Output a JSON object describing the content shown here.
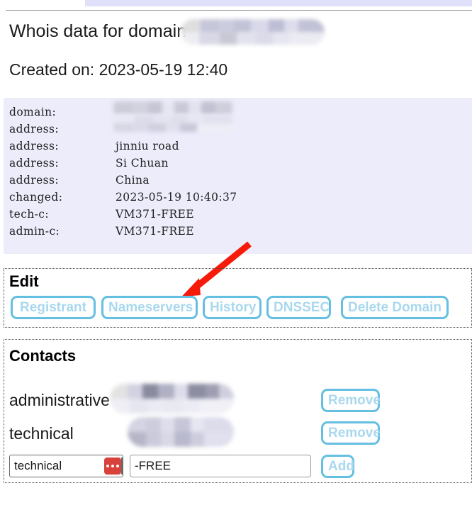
{
  "page": {
    "title": "Whois data for domain",
    "created_line": "Created on: 2023-05-19 12:40"
  },
  "whois": {
    "lines": [
      {
        "key": "domain:",
        "value": ""
      },
      {
        "key": "address:",
        "value": ""
      },
      {
        "key": "address:",
        "value": "jinniu road"
      },
      {
        "key": "address:",
        "value": "Si Chuan"
      },
      {
        "key": "address:",
        "value": "China"
      },
      {
        "key": "changed:",
        "value": "2023-05-19 10:40:37"
      },
      {
        "key": "tech-c:",
        "value": "VM371-FREE"
      },
      {
        "key": "admin-c:",
        "value": "VM371-FREE"
      }
    ]
  },
  "edit": {
    "title": "Edit",
    "buttons": [
      {
        "label": "Registrant"
      },
      {
        "label": "Nameservers"
      },
      {
        "label": "History"
      },
      {
        "label": "DNSSEC"
      },
      {
        "label": "Delete Domain"
      }
    ]
  },
  "contacts": {
    "title": "Contacts",
    "rows": [
      {
        "label": "administrative",
        "action": "Remove"
      },
      {
        "label": "technical",
        "action": "Remove"
      }
    ],
    "add_form": {
      "type_value": "technical",
      "handle_value": "-FREE",
      "handle_placeholder": "",
      "add_label": "Add"
    }
  },
  "colors": {
    "accent_border": "#64bfe0",
    "accent_text": "#a9d8ee",
    "whois_background": "#ececfb",
    "annotation_arrow": "#f61a09",
    "select_badge": "#d9413b",
    "top_strip": "#e0e0fa"
  },
  "annotation": {
    "arrow_points_to": "Nameservers"
  }
}
